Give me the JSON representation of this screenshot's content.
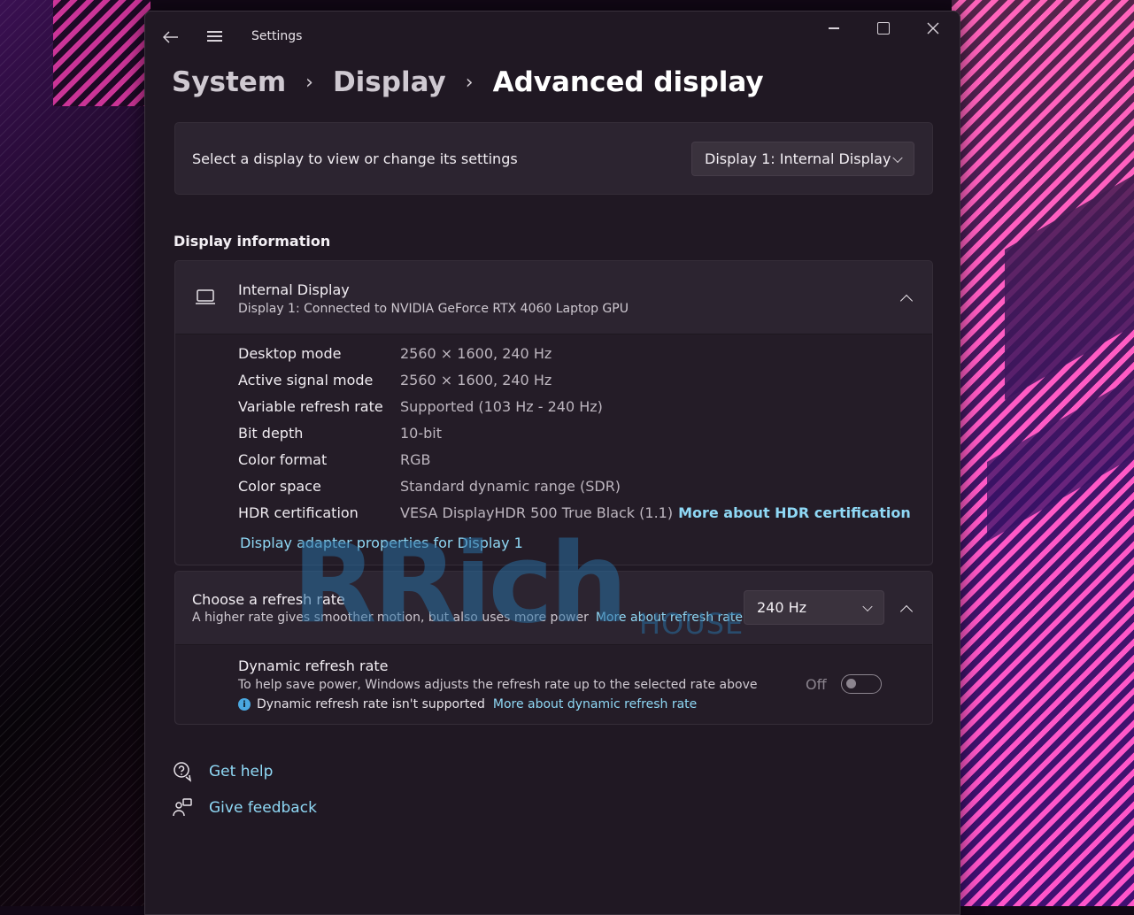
{
  "app": {
    "title": "Settings"
  },
  "breadcrumb": {
    "items": [
      "System",
      "Display",
      "Advanced display"
    ]
  },
  "selector": {
    "label": "Select a display to view or change its settings",
    "dropdown_value": "Display 1: Internal Display"
  },
  "display_info": {
    "heading": "Display information",
    "name": "Internal Display",
    "subtitle": "Display 1: Connected to NVIDIA GeForce RTX 4060 Laptop GPU",
    "properties": [
      {
        "label": "Desktop mode",
        "value": "2560 × 1600, 240 Hz"
      },
      {
        "label": "Active signal mode",
        "value": "2560 × 1600, 240 Hz"
      },
      {
        "label": "Variable refresh rate",
        "value": "Supported (103 Hz - 240 Hz)"
      },
      {
        "label": "Bit depth",
        "value": "10-bit"
      },
      {
        "label": "Color format",
        "value": "RGB"
      },
      {
        "label": "Color space",
        "value": "Standard dynamic range (SDR)"
      },
      {
        "label": "HDR certification",
        "value": "VESA DisplayHDR 500 True Black (1.1)",
        "link": "More about HDR certification"
      }
    ],
    "adapter_link": "Display adapter properties for Display 1"
  },
  "refresh": {
    "title": "Choose a refresh rate",
    "subtitle": "A higher rate gives smoother motion, but also uses more power",
    "subtitle_link": "More about refresh rate",
    "dropdown_value": "240 Hz",
    "dynamic": {
      "title": "Dynamic refresh rate",
      "subtitle": "To help save power, Windows adjusts the refresh rate up to the selected rate above",
      "note": "Dynamic refresh rate isn't supported",
      "note_link": "More about dynamic refresh rate",
      "toggle_label": "Off",
      "toggle_on": false
    }
  },
  "footer": {
    "get_help": "Get help",
    "give_feedback": "Give feedback"
  },
  "watermark": {
    "main": "RRich",
    "sub": "HOUSE"
  },
  "icons": {
    "back": "back-arrow-icon",
    "menu": "hamburger-menu-icon",
    "minimize": "minimize-icon",
    "maximize": "maximize-icon",
    "close": "close-icon",
    "laptop": "laptop-icon",
    "chevron_up": "chevron-up-icon",
    "chevron_down": "chevron-down-icon",
    "info": "info-icon",
    "help": "help-chat-icon",
    "feedback": "feedback-icon"
  },
  "colors": {
    "window_bg": "#201823",
    "card_bg": "#2c2430",
    "link": "#8fd8f5",
    "info_icon": "#4aa8e0"
  }
}
